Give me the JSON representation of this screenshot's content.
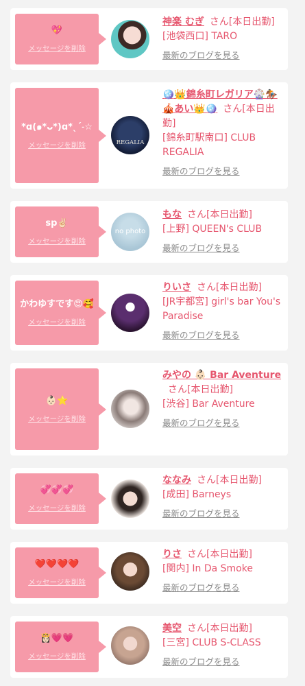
{
  "delete_label": "メッセージを削除",
  "blog_label": "最新のブログを見る",
  "entries": [
    {
      "message": "💖",
      "name": "神楽 むぎ",
      "suffix": "さん[本日出勤]",
      "shop": "[池袋西口] TARO"
    },
    {
      "message": "*ɑ(๑*ᴗ*)ɑ*ˎˊ˗☆",
      "name": "🪩👑錦糸町レガリア🎡🏇🎪あい👑🪩",
      "suffix": "さん[本日出勤]",
      "shop": "[錦糸町駅南口] CLUB REGALIA",
      "avatar_text": "REGALIA"
    },
    {
      "message": "sp✌🏻",
      "name": "もな",
      "suffix": "さん[本日出勤]",
      "shop": "[上野] QUEEN's CLUB",
      "avatar_text": "no photo"
    },
    {
      "message": "かわゆすです😍🥰",
      "name": "りいさ",
      "suffix": "さん[本日出勤]",
      "shop": "[JR宇都宮] girl's bar You's Paradise"
    },
    {
      "message": "👶🏻⭐",
      "name": "みやの 👶🏻 Bar Aventure",
      "suffix": "さん[本日出勤]",
      "shop": "[渋谷] Bar Aventure"
    },
    {
      "message": "💞💞💞",
      "name": "ななみ",
      "suffix": "さん[本日出勤]",
      "shop": "[成田] Barneys"
    },
    {
      "message": "❤️❤️❤️❤️",
      "name": "りさ",
      "suffix": "さん[本日出勤]",
      "shop": "[関内]  In Da Smoke"
    },
    {
      "message": "👸🏻💗💗",
      "name": "美空",
      "suffix": "さん[本日出勤]",
      "shop": "[三宮] CLUB S-CLASS"
    }
  ],
  "colors": {
    "accent": "#e6566e",
    "bubble": "#f69aa9",
    "background": "#f3f3f3",
    "link_gray": "#8a8a8a"
  }
}
